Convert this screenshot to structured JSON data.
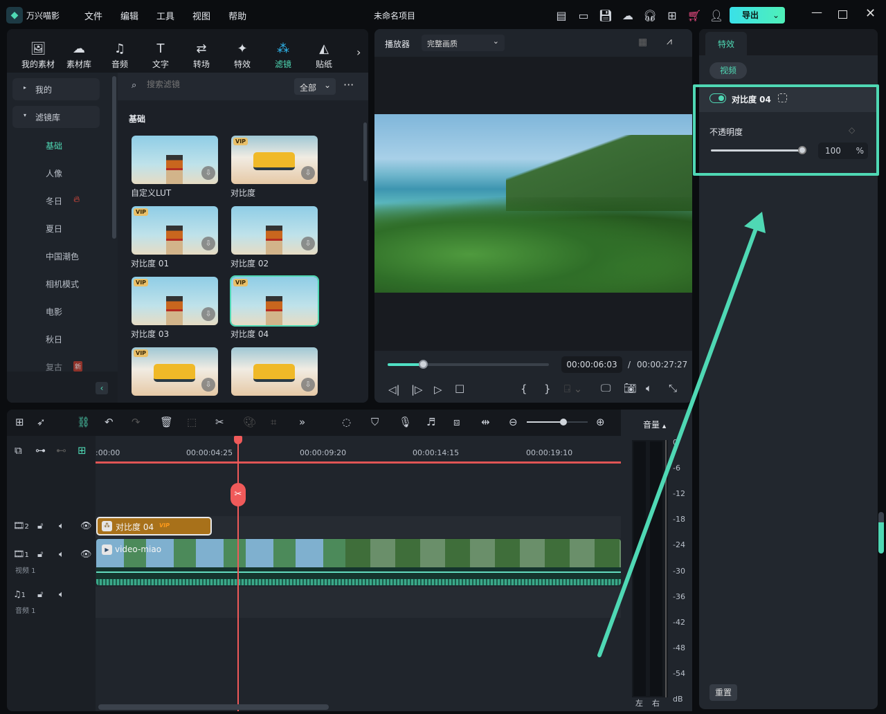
{
  "app": {
    "name": "万兴喵影",
    "project_title": "未命名项目",
    "menu": [
      "文件",
      "编辑",
      "工具",
      "视图",
      "帮助"
    ],
    "export_label": "导出",
    "accent": "#4fd8b4"
  },
  "topbar_icons": [
    "report-icon",
    "layout-icon",
    "save-icon",
    "cloud-icon",
    "headset-icon",
    "apps-icon",
    "cart-icon",
    "user-icon"
  ],
  "media_tabs": [
    {
      "label": "我的素材",
      "icon": "media-icon"
    },
    {
      "label": "素材库",
      "icon": "library-icon"
    },
    {
      "label": "音频",
      "icon": "music-icon"
    },
    {
      "label": "文字",
      "icon": "text-icon"
    },
    {
      "label": "转场",
      "icon": "transition-icon"
    },
    {
      "label": "特效",
      "icon": "effects-icon"
    },
    {
      "label": "滤镜",
      "icon": "filter-icon",
      "active": true
    },
    {
      "label": "贴纸",
      "icon": "sticker-icon"
    }
  ],
  "sidebar": {
    "groups": [
      "我的",
      "滤镜库"
    ],
    "items": [
      {
        "label": "基础",
        "active": true
      },
      {
        "label": "人像"
      },
      {
        "label": "冬日",
        "badge": "hot"
      },
      {
        "label": "夏日"
      },
      {
        "label": "中国潮色"
      },
      {
        "label": "相机模式"
      },
      {
        "label": "电影"
      },
      {
        "label": "秋日"
      },
      {
        "label": "复古",
        "badge": "新"
      }
    ]
  },
  "filters": {
    "search_placeholder": "搜索滤镜",
    "dropdown": "全部",
    "section": "基础",
    "items": [
      {
        "name": "自定义LUT",
        "vip": false,
        "img": "lighthouse"
      },
      {
        "name": "对比度",
        "vip": true,
        "img": "bus"
      },
      {
        "name": "对比度 01",
        "vip": true,
        "img": "lighthouse"
      },
      {
        "name": "对比度 02",
        "vip": false,
        "img": "lighthouse"
      },
      {
        "name": "对比度 03",
        "vip": true,
        "img": "lighthouse"
      },
      {
        "name": "对比度 04",
        "vip": true,
        "img": "lighthouse",
        "selected": true
      },
      {
        "name": "",
        "vip": true,
        "img": "bus"
      },
      {
        "name": "",
        "vip": false,
        "img": "bus"
      }
    ],
    "vip_label": "VIP"
  },
  "player": {
    "title": "播放器",
    "quality": "完整画质",
    "current_time": "00:00:06:03",
    "separator": "/",
    "total_time": "00:00:27:27",
    "progress": 0.22
  },
  "inspector": {
    "tab": "特效",
    "subtab": "视频",
    "effect_name": "对比度 04",
    "enabled": true,
    "opacity_label": "不透明度",
    "opacity_value": "100",
    "opacity_unit": "%",
    "opacity": 100,
    "reset": "重置"
  },
  "timeline": {
    "ruler": [
      ":00:00",
      "00:00:04:25",
      "00:00:09:20",
      "00:00:14:15",
      "00:00:19:10"
    ],
    "filter_clip": "对比度 04",
    "filter_clip_vip": "VIP",
    "video_clip": "video-miao",
    "tracks": [
      {
        "num": "2"
      },
      {
        "num": "1",
        "label": "视频 1"
      },
      {
        "num": "1",
        "label": "音频 1"
      }
    ],
    "zoom": 0.6
  },
  "meter": {
    "title": "音量",
    "scale": [
      "0",
      "-6",
      "-12",
      "-18",
      "-24",
      "-30",
      "-36",
      "-42",
      "-48",
      "-54",
      "dB"
    ],
    "channels": [
      "左",
      "右"
    ]
  }
}
